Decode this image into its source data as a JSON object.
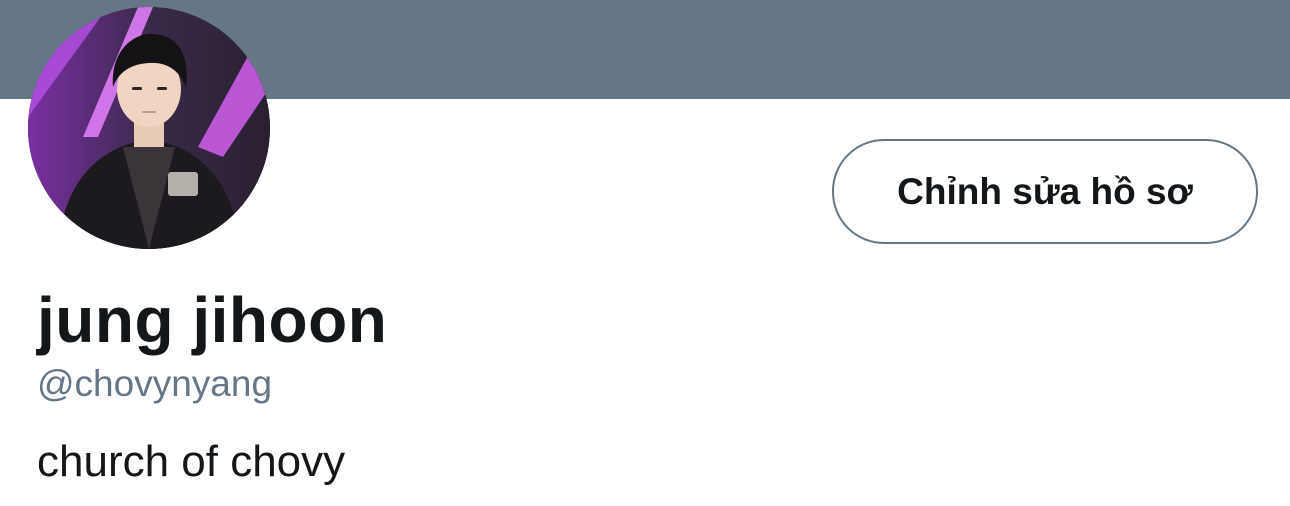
{
  "profile": {
    "banner_color": "#657786",
    "display_name": "jung jihoon",
    "handle": "@chovynyang",
    "bio": "church of chovy",
    "edit_button_label": "Chỉnh sửa hồ sơ"
  },
  "colors": {
    "text_primary": "#14171a",
    "text_secondary": "#657786",
    "avatar_accent": "#c04ce0"
  }
}
